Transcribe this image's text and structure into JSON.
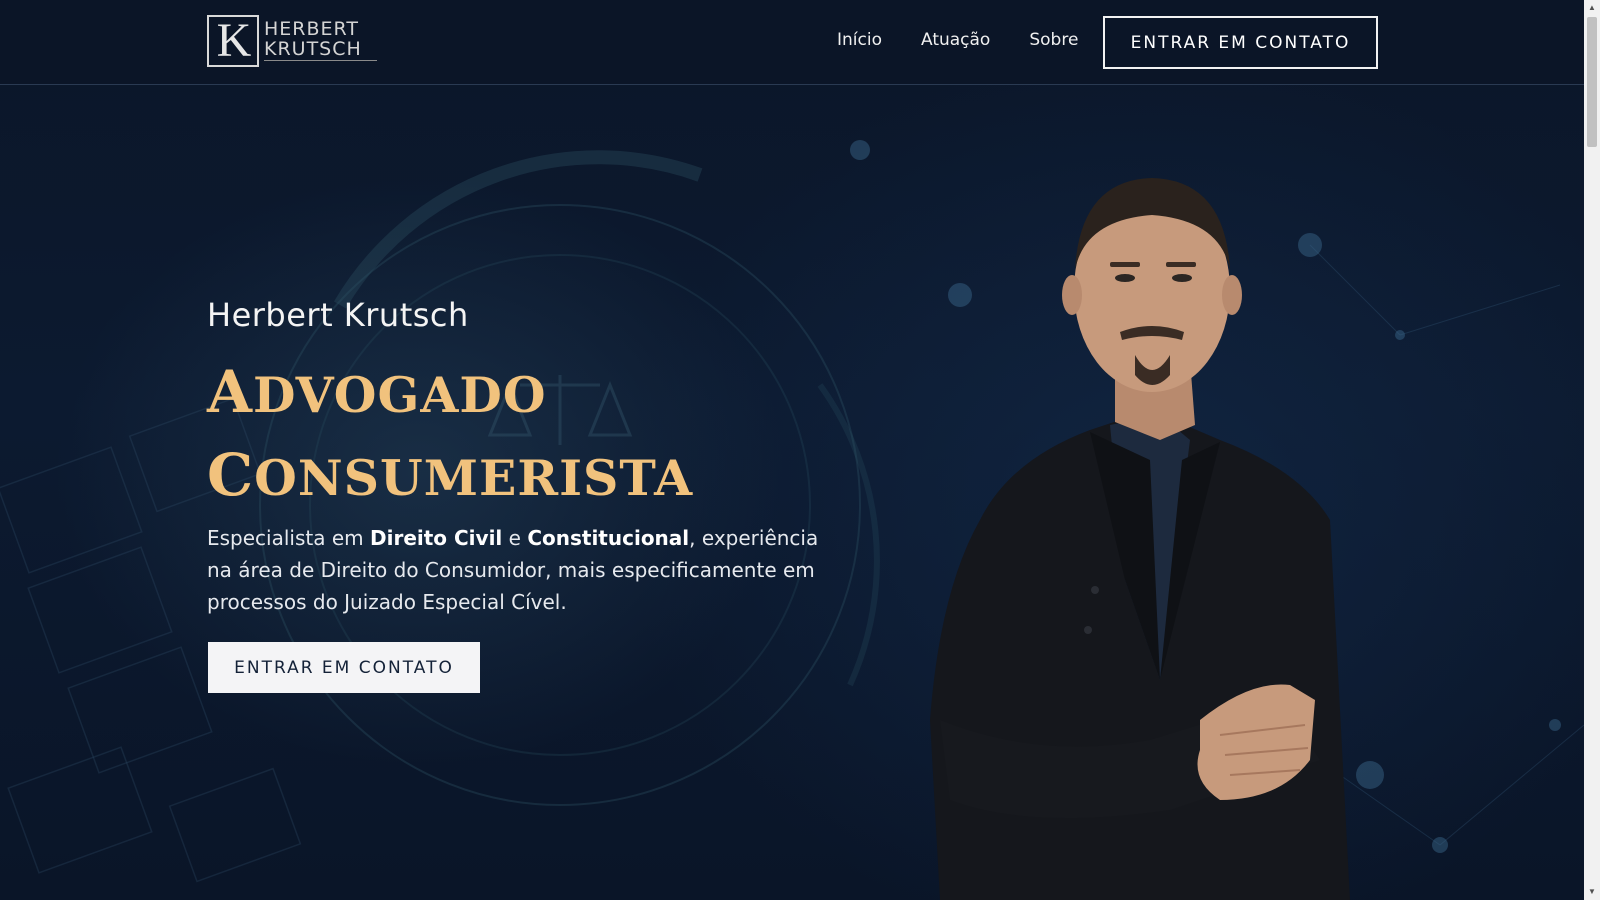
{
  "header": {
    "logo": {
      "letter": "K",
      "line1": "HERBERT",
      "line2": "KRUTSCH"
    },
    "nav": [
      {
        "label": "Início"
      },
      {
        "label": "Atuação"
      },
      {
        "label": "Sobre"
      }
    ],
    "cta_label": "ENTRAR EM CONTATO"
  },
  "hero": {
    "name": "Herbert Krutsch",
    "title_line1_cap": "A",
    "title_line1_rest": "DVOGADO",
    "title_line2_cap": "C",
    "title_line2_rest": "ONSUMERISTA",
    "desc_part1": "Especialista em ",
    "desc_bold1": "Direito Civil",
    "desc_part2": " e ",
    "desc_bold2": "Constitucional",
    "desc_part3": ", experiência na área de Direito do Consumidor, mais especificamente em processos do Juizado Especial Cível.",
    "cta_label": "ENTRAR EM CONTATO"
  },
  "colors": {
    "background": "#0b1629",
    "accent_gold": "#f1c27d",
    "text_light": "#f4f4f4"
  },
  "icons": {
    "scroll_up": "▲",
    "scroll_down": "▼"
  }
}
